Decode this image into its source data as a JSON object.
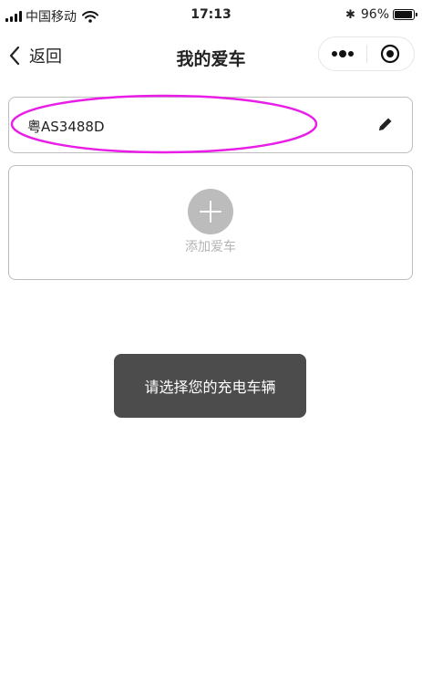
{
  "status_bar": {
    "carrier": "中国移动",
    "time": "17:13",
    "battery_text": "96%",
    "battery_level": 0.96,
    "icons": [
      "signal-icon",
      "wifi-icon",
      "bluetooth-icon",
      "battery-icon"
    ]
  },
  "nav": {
    "back_label": "返回",
    "title": "我的爱车",
    "icons": [
      "chevron-left-icon",
      "more-icon",
      "target-icon"
    ]
  },
  "car": {
    "plate": "粤AS3488D",
    "edit_icon": "pencil-icon",
    "highlight_color": "#e81ee8"
  },
  "add_car": {
    "label": "添加爱车",
    "icon": "plus-icon"
  },
  "toast": {
    "message": "请选择您的充电车辆"
  }
}
